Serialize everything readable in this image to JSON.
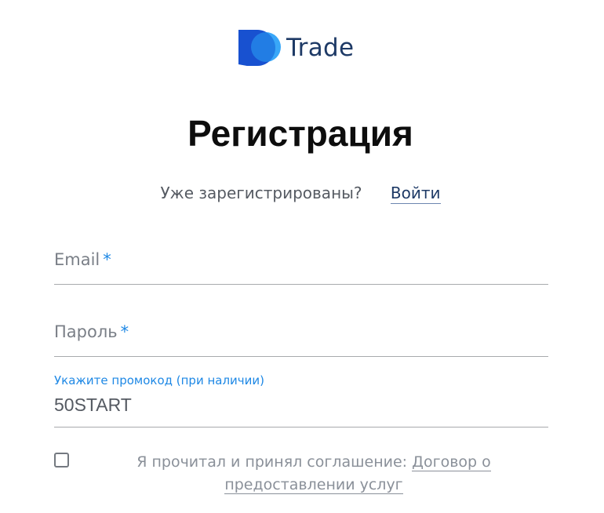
{
  "logo": {
    "text": "Trade",
    "icon": "po-logo-icon",
    "colors": {
      "dark": "#1e5bd8",
      "light": "#2ea2f8",
      "text": "#1e3a66"
    }
  },
  "page": {
    "title": "Регистрация"
  },
  "login_prompt": {
    "question": "Уже зарегистрированы?",
    "link_label": "Войти"
  },
  "form": {
    "email": {
      "placeholder": "Email",
      "required_mark": "*"
    },
    "password": {
      "placeholder": "Пароль",
      "required_mark": "*"
    },
    "promo": {
      "label": "Укажите промокод (при наличии)",
      "value": "50START"
    },
    "agreement": {
      "checked": false,
      "text": "Я прочитал и принял соглашение:",
      "link_label": "Договор о предоставлении услуг"
    }
  },
  "colors": {
    "accent": "#1e88e5",
    "link": "#1e3a66",
    "muted_text": "#7a7f87"
  }
}
